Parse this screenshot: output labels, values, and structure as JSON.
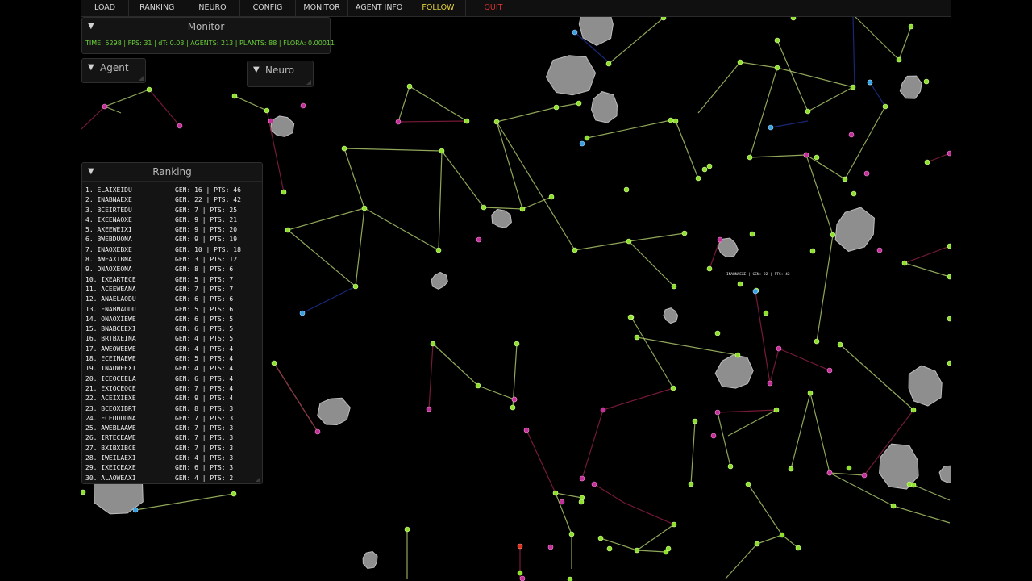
{
  "menubar": {
    "items": [
      {
        "label": "LOAD",
        "color": "#d8d8d8"
      },
      {
        "label": "RANKING",
        "color": "#d8d8d8"
      },
      {
        "label": "NEURO",
        "color": "#d8d8d8"
      },
      {
        "label": "CONFIG",
        "color": "#d8d8d8"
      },
      {
        "label": "MONITOR",
        "color": "#d8d8d8"
      },
      {
        "label": "AGENT INFO",
        "color": "#d8d8d8"
      },
      {
        "label": "FOLLOW",
        "color": "#e6d43a"
      },
      {
        "label": "QUIT",
        "color": "#d03030"
      }
    ]
  },
  "monitor": {
    "title": "Monitor",
    "status": "TIME: 5298 | FPS: 31 | dT: 0.03 | AGENTS: 213 | PLANTS: 88 | FLORA: 0.00011"
  },
  "agent_panel": {
    "title": "Agent"
  },
  "neuro_panel": {
    "title": "Neuro"
  },
  "ranking": {
    "title": "Ranking",
    "rows": [
      {
        "rank": "1.",
        "name": "ELAIXEIDU",
        "stats": "GEN: 16 | PTS: 46"
      },
      {
        "rank": "2.",
        "name": "INABNAEXE",
        "stats": "GEN: 22 | PTS: 42"
      },
      {
        "rank": "3.",
        "name": "BCEIRTEDU",
        "stats": "GEN: 7 | PTS: 25"
      },
      {
        "rank": "4.",
        "name": "IXEENAOXE",
        "stats": "GEN: 9 | PTS: 21"
      },
      {
        "rank": "5.",
        "name": "AXEEWEIXI",
        "stats": "GEN: 9 | PTS: 20"
      },
      {
        "rank": "6.",
        "name": "BWEBDUONA",
        "stats": "GEN: 9 | PTS: 19"
      },
      {
        "rank": "7.",
        "name": "INAOXEBXE",
        "stats": "GEN: 10 | PTS: 18"
      },
      {
        "rank": "8.",
        "name": "AWEAXIBNA",
        "stats": "GEN: 3 | PTS: 12"
      },
      {
        "rank": "9.",
        "name": "ONAOXEONA",
        "stats": "GEN: 8 | PTS: 6"
      },
      {
        "rank": "10.",
        "name": "IXEARTECE",
        "stats": "GEN: 5 | PTS: 7"
      },
      {
        "rank": "11.",
        "name": "ACEEWEANA",
        "stats": "GEN: 7 | PTS: 7"
      },
      {
        "rank": "12.",
        "name": "ANAELAODU",
        "stats": "GEN: 6 | PTS: 6"
      },
      {
        "rank": "13.",
        "name": "ENABNAODU",
        "stats": "GEN: 5 | PTS: 6"
      },
      {
        "rank": "14.",
        "name": "ONAOXIEWE",
        "stats": "GEN: 6 | PTS: 5"
      },
      {
        "rank": "15.",
        "name": "BNABCEEXI",
        "stats": "GEN: 6 | PTS: 5"
      },
      {
        "rank": "16.",
        "name": "BRTBXEINA",
        "stats": "GEN: 4 | PTS: 5"
      },
      {
        "rank": "17.",
        "name": "AWEOWEEWE",
        "stats": "GEN: 4 | PTS: 4"
      },
      {
        "rank": "18.",
        "name": "ECEINAEWE",
        "stats": "GEN: 5 | PTS: 4"
      },
      {
        "rank": "19.",
        "name": "INAOWEEXI",
        "stats": "GEN: 4 | PTS: 4"
      },
      {
        "rank": "20.",
        "name": "ICEOCEELA",
        "stats": "GEN: 6 | PTS: 4"
      },
      {
        "rank": "21.",
        "name": "EXIOCEOCE",
        "stats": "GEN: 7 | PTS: 4"
      },
      {
        "rank": "22.",
        "name": "ACEIXIEXE",
        "stats": "GEN: 9 | PTS: 4"
      },
      {
        "rank": "23.",
        "name": "BCEOXIBRT",
        "stats": "GEN: 8 | PTS: 3"
      },
      {
        "rank": "24.",
        "name": "ECEODUONA",
        "stats": "GEN: 7 | PTS: 3"
      },
      {
        "rank": "25.",
        "name": "AWEBLAAWE",
        "stats": "GEN: 7 | PTS: 3"
      },
      {
        "rank": "26.",
        "name": "IRTECEAWE",
        "stats": "GEN: 7 | PTS: 3"
      },
      {
        "rank": "27.",
        "name": "BXIBXIBCE",
        "stats": "GEN: 7 | PTS: 3"
      },
      {
        "rank": "28.",
        "name": "IWEILAEXI",
        "stats": "GEN: 4 | PTS: 3"
      },
      {
        "rank": "29.",
        "name": "IXEICEAXE",
        "stats": "GEN: 6 | PTS: 3"
      },
      {
        "rank": "30.",
        "name": "ALAOWEAXI",
        "stats": "GEN: 4 | PTS: 2"
      }
    ]
  },
  "floating_label": "INABNAEXE | GEN: 22 | PTS: 42",
  "colors": {
    "node_green": "#8ee02c",
    "node_magenta": "#c4309a",
    "node_blue": "#3aa0e0",
    "link_green": "#a9c46a",
    "link_red": "#8a1f40",
    "link_blue": "#1c2e8a",
    "rock": "#8e8e8e"
  }
}
